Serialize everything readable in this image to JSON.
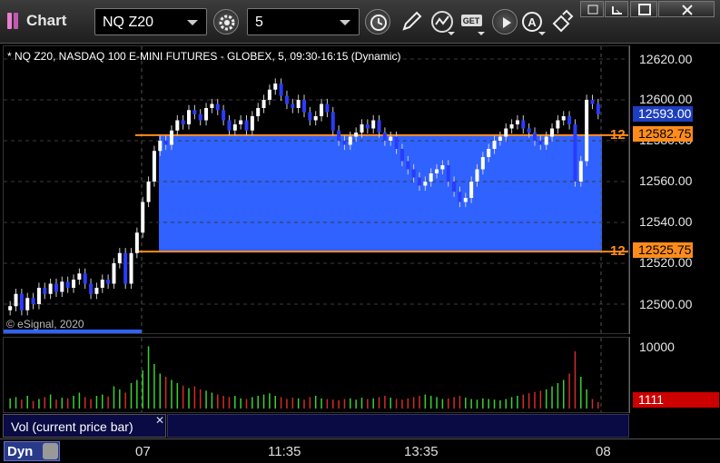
{
  "window": {
    "title": "Chart",
    "symbol": "NQ Z20",
    "interval": "5"
  },
  "chart": {
    "description": "* NQ Z20, NASDAQ 100 E-MINI FUTURES - GLOBEX, 5, 09:30-16:15 (Dynamic)",
    "copyright": "© eSignal, 2020",
    "price_labels": [
      "12620.00",
      "12600.00",
      "12580.00",
      "12560.00",
      "12540.00",
      "12520.00",
      "12500.00"
    ],
    "price_tags": {
      "last": "12593.00",
      "upper_level": "12582.75",
      "lower_level": "12525.75"
    },
    "level_label_upper": "12",
    "level_label_lower": "12",
    "colors": {
      "zone": "#2f62ff",
      "level_line": "#ff8c1a",
      "up_candle": "#ffffff",
      "down_candle": "#2a3cff",
      "vol_up": "#39d22e",
      "vol_down": "#d42a2a",
      "vol_tag": "#cc0000"
    }
  },
  "volume": {
    "label": "Vol (current price bar)",
    "axis_label": "10000",
    "last_tag": "1111"
  },
  "time_axis": {
    "labels": [
      "07",
      "11:35",
      "13:35",
      "08"
    ],
    "mode": "Dyn"
  },
  "chart_data": {
    "type": "candlestick",
    "title": "* NQ Z20, NASDAQ 100 E-MINI FUTURES - GLOBEX, 5, 09:30-16:15 (Dynamic)",
    "yaxis_ticks": [
      12500,
      12520,
      12540,
      12560,
      12580,
      12600,
      12620
    ],
    "last_price": 12593.0,
    "levels": [
      12582.75,
      12525.75
    ],
    "closes": [
      12499,
      12505,
      12497,
      12503,
      12500,
      12508,
      12505,
      12510,
      12506,
      12511,
      12508,
      12512,
      12515,
      12510,
      12505,
      12508,
      12512,
      12510,
      12520,
      12525,
      12510,
      12525,
      12535,
      12550,
      12560,
      12575,
      12580,
      12578,
      12585,
      12590,
      12588,
      12595,
      12593,
      12590,
      12596,
      12598,
      12595,
      12590,
      12585,
      12588,
      12590,
      12585,
      12592,
      12596,
      12600,
      12605,
      12608,
      12602,
      12598,
      12596,
      12600,
      12594,
      12590,
      12592,
      12598,
      12594,
      12585,
      12580,
      12578,
      12582,
      12584,
      12588,
      12586,
      12590,
      12584,
      12580,
      12582,
      12576,
      12570,
      12566,
      12562,
      12558,
      12560,
      12564,
      12566,
      12568,
      12560,
      12555,
      12550,
      12552,
      12560,
      12566,
      12572,
      12576,
      12580,
      12582,
      12586,
      12588,
      12590,
      12586,
      12584,
      12580,
      12578,
      12582,
      12586,
      12590,
      12592,
      12588,
      12560,
      12570,
      12600,
      12598,
      12593
    ],
    "volume_ratio": [
      0.16,
      0.18,
      0.14,
      0.2,
      0.12,
      0.15,
      0.18,
      0.22,
      0.14,
      0.17,
      0.16,
      0.2,
      0.25,
      0.18,
      0.15,
      0.2,
      0.22,
      0.19,
      0.35,
      0.3,
      0.25,
      0.4,
      0.45,
      0.6,
      0.98,
      0.7,
      0.55,
      0.5,
      0.45,
      0.4,
      0.36,
      0.32,
      0.35,
      0.3,
      0.28,
      0.25,
      0.22,
      0.2,
      0.18,
      0.2,
      0.16,
      0.15,
      0.18,
      0.2,
      0.22,
      0.24,
      0.2,
      0.18,
      0.15,
      0.17,
      0.16,
      0.14,
      0.18,
      0.2,
      0.16,
      0.15,
      0.14,
      0.13,
      0.15,
      0.16,
      0.14,
      0.17,
      0.15,
      0.16,
      0.18,
      0.2,
      0.17,
      0.15,
      0.14,
      0.16,
      0.18,
      0.2,
      0.22,
      0.2,
      0.18,
      0.15,
      0.16,
      0.18,
      0.2,
      0.17,
      0.15,
      0.14,
      0.16,
      0.15,
      0.14,
      0.13,
      0.15,
      0.18,
      0.2,
      0.22,
      0.24,
      0.26,
      0.28,
      0.3,
      0.35,
      0.4,
      0.45,
      0.55,
      0.9,
      0.5,
      0.3,
      0.15,
      0.1
    ]
  }
}
